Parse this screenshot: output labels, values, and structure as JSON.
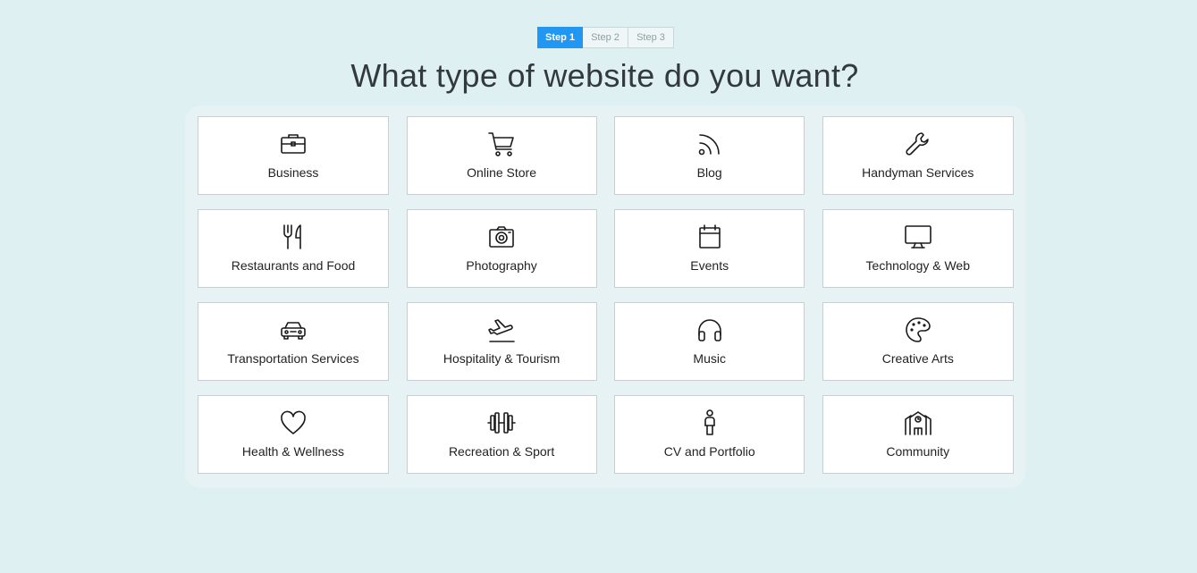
{
  "stepper": {
    "steps": [
      {
        "label": "Step 1",
        "active": true
      },
      {
        "label": "Step 2",
        "active": false
      },
      {
        "label": "Step 3",
        "active": false
      }
    ]
  },
  "page": {
    "title": "What type of website do you want?"
  },
  "categories": [
    {
      "label": "Business",
      "icon": "briefcase-icon"
    },
    {
      "label": "Online Store",
      "icon": "shopping-cart-icon"
    },
    {
      "label": "Blog",
      "icon": "rss-icon"
    },
    {
      "label": "Handyman Services",
      "icon": "wrench-icon"
    },
    {
      "label": "Restaurants and Food",
      "icon": "fork-knife-icon"
    },
    {
      "label": "Photography",
      "icon": "camera-icon"
    },
    {
      "label": "Events",
      "icon": "calendar-icon"
    },
    {
      "label": "Technology & Web",
      "icon": "monitor-icon"
    },
    {
      "label": "Transportation Services",
      "icon": "car-icon"
    },
    {
      "label": "Hospitality & Tourism",
      "icon": "airplane-icon"
    },
    {
      "label": "Music",
      "icon": "headphones-icon"
    },
    {
      "label": "Creative Arts",
      "icon": "palette-icon"
    },
    {
      "label": "Health & Wellness",
      "icon": "heart-icon"
    },
    {
      "label": "Recreation & Sport",
      "icon": "dumbbell-icon"
    },
    {
      "label": "CV and Portfolio",
      "icon": "person-icon"
    },
    {
      "label": "Community",
      "icon": "community-building-icon"
    }
  ],
  "colors": {
    "background": "#dff0f3",
    "accent": "#2196f3",
    "card": "#ffffff"
  }
}
